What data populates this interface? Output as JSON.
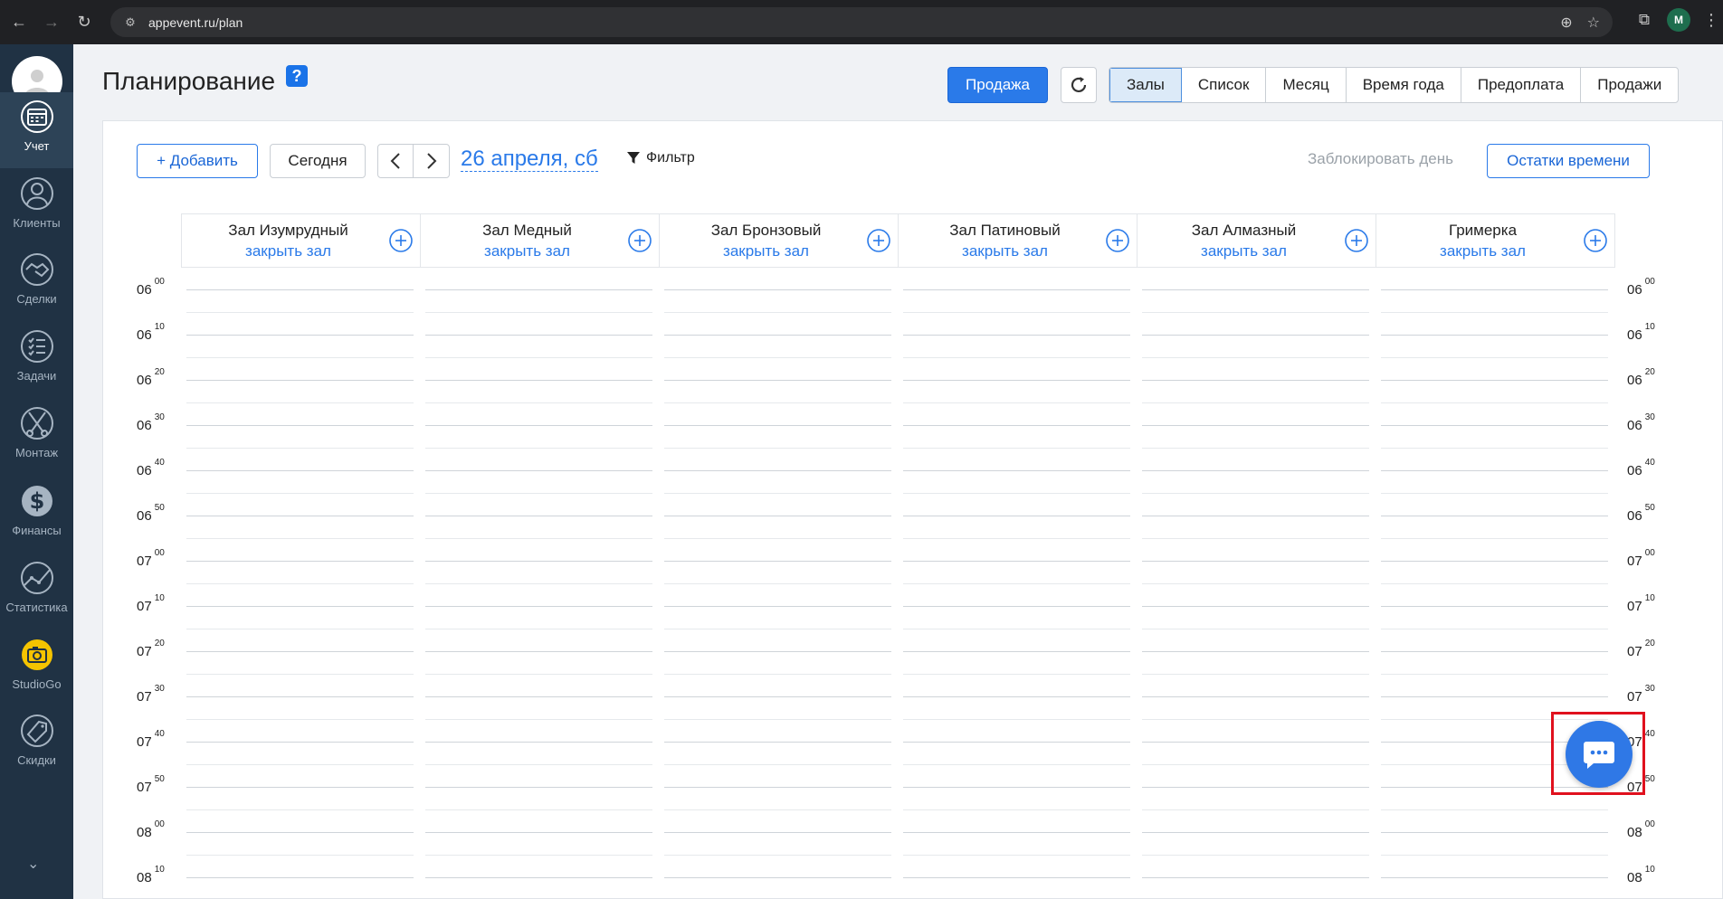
{
  "browser": {
    "url": "appevent.ru/plan",
    "profile_initial": "M"
  },
  "sidebar": {
    "items": [
      {
        "label": "Учет",
        "icon": "calendar-icon"
      },
      {
        "label": "Клиенты",
        "icon": "user-icon"
      },
      {
        "label": "Сделки",
        "icon": "handshake-icon"
      },
      {
        "label": "Задачи",
        "icon": "checklist-icon"
      },
      {
        "label": "Монтаж",
        "icon": "scissors-icon"
      },
      {
        "label": "Финансы",
        "icon": "dollar-icon"
      },
      {
        "label": "Статистика",
        "icon": "chart-line-icon"
      },
      {
        "label": "StudioGo",
        "icon": "camera-icon"
      },
      {
        "label": "Скидки",
        "icon": "sale-tag-icon"
      }
    ]
  },
  "header": {
    "title": "Планирование",
    "help": "?",
    "sale_button": "Продажа",
    "tabs": [
      "Залы",
      "Список",
      "Месяц",
      "Время года",
      "Предоплата",
      "Продажи"
    ],
    "active_tab": "Залы"
  },
  "toolbar": {
    "add": "+ Добавить",
    "today": "Сегодня",
    "prev": "‹",
    "next": "›",
    "date": "26 апреля, сб",
    "filter": "Фильтр",
    "block_day": "Заблокировать день",
    "time_left": "Остатки времени"
  },
  "halls": [
    {
      "name": "Зал Изумрудный",
      "close": "закрыть зал"
    },
    {
      "name": "Зал Медный",
      "close": "закрыть зал"
    },
    {
      "name": "Зал Бронзовый",
      "close": "закрыть зал"
    },
    {
      "name": "Зал Патиновый",
      "close": "закрыть зал"
    },
    {
      "name": "Зал Алмазный",
      "close": "закрыть зал"
    },
    {
      "name": "Гримерка",
      "close": "закрыть зал"
    }
  ],
  "times": [
    {
      "h": "06",
      "m": "00"
    },
    {
      "h": "06",
      "m": "10"
    },
    {
      "h": "06",
      "m": "20"
    },
    {
      "h": "06",
      "m": "30"
    },
    {
      "h": "06",
      "m": "40"
    },
    {
      "h": "06",
      "m": "50"
    },
    {
      "h": "07",
      "m": "00"
    },
    {
      "h": "07",
      "m": "10"
    },
    {
      "h": "07",
      "m": "20"
    },
    {
      "h": "07",
      "m": "30"
    },
    {
      "h": "07",
      "m": "40"
    },
    {
      "h": "07",
      "m": "50"
    },
    {
      "h": "08",
      "m": "00"
    },
    {
      "h": "08",
      "m": "10"
    }
  ],
  "colors": {
    "primary": "#2a7ae9",
    "sidebar": "#203244",
    "highlight": "#e0111e",
    "studiogo": "#f5c400"
  }
}
